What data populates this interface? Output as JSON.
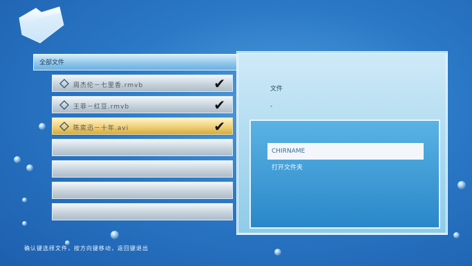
{
  "header": {
    "title": "全部文件"
  },
  "files": [
    {
      "name": "周杰伦－七里香.rmvb",
      "checked": true,
      "selected": false
    },
    {
      "name": "王菲－红豆.rmvb",
      "checked": true,
      "selected": false
    },
    {
      "name": "陈奕迅－十年.avi",
      "checked": true,
      "selected": true
    },
    {
      "name": "",
      "checked": false,
      "selected": false
    },
    {
      "name": "",
      "checked": false,
      "selected": false
    },
    {
      "name": "",
      "checked": false,
      "selected": false
    },
    {
      "name": "",
      "checked": false,
      "selected": false
    }
  ],
  "check_mark": "✔",
  "panel": {
    "info_line1": "文件",
    "info_line2": "-",
    "menu": [
      {
        "label": "CHIRNAME",
        "selected": true
      },
      {
        "label": "打开文件夹",
        "selected": false
      }
    ]
  },
  "footer": {
    "hint": "确认键选择文件，按方向键移动，返回键退出"
  },
  "colors": {
    "selected_row": "#f0cf78",
    "panel_bg": "#9fd3ec",
    "background": "#2a78c6"
  }
}
